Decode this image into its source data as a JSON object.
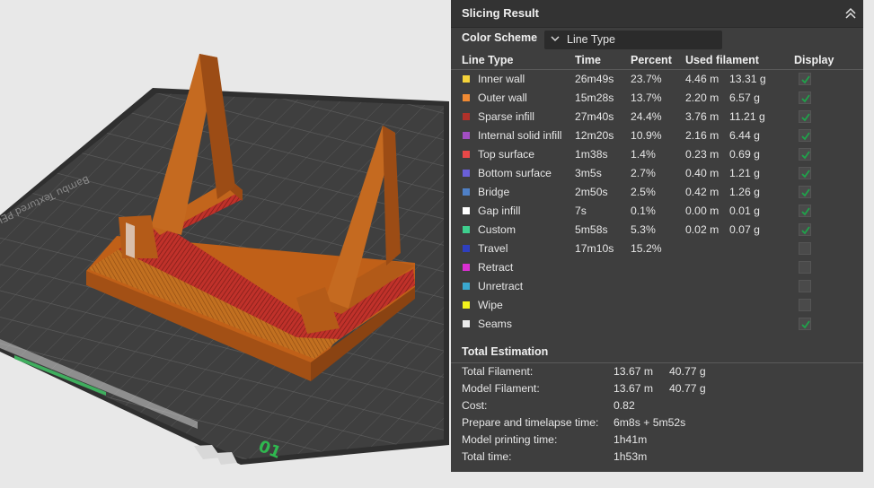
{
  "panel": {
    "title": "Slicing Result",
    "color_scheme_label": "Color Scheme",
    "color_scheme_value": "Line Type",
    "columns": [
      "Line Type",
      "Time",
      "Percent",
      "Used filament",
      "Display"
    ],
    "rows": [
      {
        "name": "Inner wall",
        "color": "#f5d33a",
        "time": "26m49s",
        "percent": "23.7%",
        "length": "4.46 m",
        "weight": "13.31 g",
        "display": true
      },
      {
        "name": "Outer wall",
        "color": "#f08a33",
        "time": "15m28s",
        "percent": "13.7%",
        "length": "2.20 m",
        "weight": "6.57 g",
        "display": true
      },
      {
        "name": "Sparse infill",
        "color": "#b0312a",
        "time": "27m40s",
        "percent": "24.4%",
        "length": "3.76 m",
        "weight": "11.21 g",
        "display": true
      },
      {
        "name": "Internal solid infill",
        "color": "#a24ec2",
        "time": "12m20s",
        "percent": "10.9%",
        "length": "2.16 m",
        "weight": "6.44 g",
        "display": true
      },
      {
        "name": "Top surface",
        "color": "#e84848",
        "time": "1m38s",
        "percent": "1.4%",
        "length": "0.23 m",
        "weight": "0.69 g",
        "display": true
      },
      {
        "name": "Bottom surface",
        "color": "#6a5fd8",
        "time": "3m5s",
        "percent": "2.7%",
        "length": "0.40 m",
        "weight": "1.21 g",
        "display": true
      },
      {
        "name": "Bridge",
        "color": "#4f80c7",
        "time": "2m50s",
        "percent": "2.5%",
        "length": "0.42 m",
        "weight": "1.26 g",
        "display": true
      },
      {
        "name": "Gap infill",
        "color": "#ffffff",
        "time": "7s",
        "percent": "0.1%",
        "length": "0.00 m",
        "weight": "0.01 g",
        "display": true
      },
      {
        "name": "Custom",
        "color": "#3ecf8e",
        "time": "5m58s",
        "percent": "5.3%",
        "length": "0.02 m",
        "weight": "0.07 g",
        "display": true
      },
      {
        "name": "Travel",
        "color": "#2e3fbf",
        "time": "17m10s",
        "percent": "15.2%",
        "length": "",
        "weight": "",
        "display": false
      },
      {
        "name": "Retract",
        "color": "#d92fd1",
        "time": "",
        "percent": "",
        "length": "",
        "weight": "",
        "display": false
      },
      {
        "name": "Unretract",
        "color": "#3aa8d0",
        "time": "",
        "percent": "",
        "length": "",
        "weight": "",
        "display": false
      },
      {
        "name": "Wipe",
        "color": "#f2f21c",
        "time": "",
        "percent": "",
        "length": "",
        "weight": "",
        "display": false
      },
      {
        "name": "Seams",
        "color": "#ebebeb",
        "time": "",
        "percent": "",
        "length": "",
        "weight": "",
        "display": true
      }
    ],
    "total_title": "Total Estimation",
    "totals": [
      {
        "label": "Total Filament:",
        "value": "13.67 m",
        "weight": "40.77 g"
      },
      {
        "label": "Model Filament:",
        "value": "13.67 m",
        "weight": "40.77 g"
      },
      {
        "label": "Cost:",
        "value": "0.82",
        "weight": ""
      },
      {
        "label": "Prepare and timelapse time:",
        "value": "6m8s + 5m52s",
        "weight": ""
      },
      {
        "label": "Model printing time:",
        "value": "1h41m",
        "weight": ""
      },
      {
        "label": "Total time:",
        "value": "1h53m",
        "weight": ""
      }
    ]
  },
  "viewport": {
    "plate_number": "01",
    "plate_label": "Bambu Textured PEI Plate",
    "model_color": "#c0651c",
    "infill_color": "#c0312a"
  }
}
